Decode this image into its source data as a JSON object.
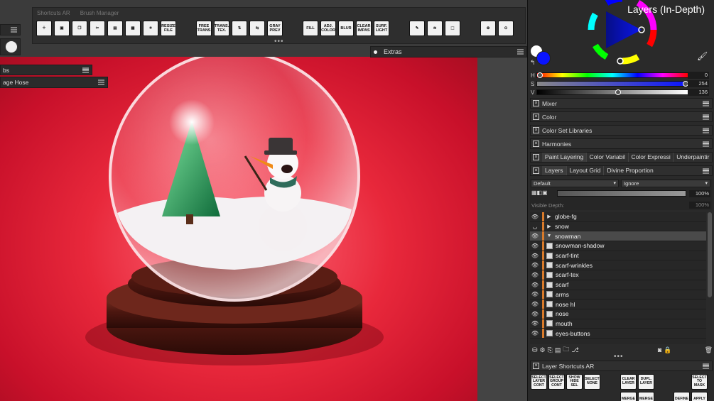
{
  "toolbar": {
    "tabs": [
      "Shortcuts AR",
      "Brush Manager"
    ],
    "buttons": [
      {
        "id": "new",
        "label": "",
        "icon": "new-doc-icon"
      },
      {
        "id": "save",
        "label": "",
        "icon": "save-icon"
      },
      {
        "id": "copy-merged",
        "label": "",
        "icon": "copy-icon"
      },
      {
        "id": "cut",
        "label": "",
        "icon": "scissors-icon"
      },
      {
        "id": "copy",
        "label": "",
        "icon": "copy-layer-icon"
      },
      {
        "id": "paste",
        "label": "",
        "icon": "paste-icon"
      },
      {
        "id": "crop",
        "label": "",
        "icon": "crop-icon"
      },
      {
        "id": "resize",
        "label": "RESIZE FILE"
      },
      {
        "id": "free-trans",
        "label": "FREE TRANS"
      },
      {
        "id": "trans-tex",
        "label": "TRANS. TEX."
      },
      {
        "id": "flip",
        "label": "",
        "icon": "flip-icon"
      },
      {
        "id": "mirror",
        "label": "",
        "icon": "mirror-icon"
      },
      {
        "id": "gray-prev",
        "label": "GRAY PREV"
      },
      {
        "id": "fill",
        "label": "FILL"
      },
      {
        "id": "adj-color",
        "label": "ADJ. COLOR"
      },
      {
        "id": "blur",
        "label": "BLUR"
      },
      {
        "id": "clear-impas",
        "label": "CLEAR IMPAS"
      },
      {
        "id": "surf-light",
        "label": "SURF. LIGHT"
      },
      {
        "id": "brush-a",
        "label": "",
        "icon": "brush-icon"
      },
      {
        "id": "brush-b",
        "label": "",
        "icon": "brush-stroke-icon"
      },
      {
        "id": "brush-c",
        "label": "",
        "icon": "cube-brush-icon"
      },
      {
        "id": "zoom-fit",
        "label": "",
        "icon": "zoom-fit-icon"
      },
      {
        "id": "zoom-100",
        "label": "",
        "icon": "zoom-100-icon"
      }
    ]
  },
  "left_panels": {
    "tab_fragment": "bs",
    "hose_label": "age Hose"
  },
  "extras": {
    "title": "Extras"
  },
  "color_panel": {
    "title": "Layers (In-Depth)",
    "sliders": [
      {
        "label": "H",
        "value": "0",
        "fraction": 0.0
      },
      {
        "label": "S",
        "value": "254",
        "fraction": 0.996
      },
      {
        "label": "V",
        "value": "136",
        "fraction": 0.533
      }
    ],
    "fg_color": "#ffffff",
    "bg_color": "#0a14ff"
  },
  "dockers": [
    {
      "title": "Mixer"
    },
    {
      "title": "Color"
    },
    {
      "title": "Color Set Libraries"
    },
    {
      "title": "Harmonies"
    }
  ],
  "paint_tabs": [
    "Paint Layering",
    "Color Variabil",
    "Color Expressi",
    "Underpaintir"
  ],
  "layers_tabs": [
    "Layers",
    "Layout Grid",
    "Divine Proportion"
  ],
  "layers_controls": {
    "blend_mode": "Default",
    "ignore_mode": "Ignore",
    "opacity": "100%",
    "visible_depth_label": "Visible Depth:",
    "visible_depth_value": "100%"
  },
  "layers": [
    {
      "name": "globe-fg",
      "type": "group",
      "expanded": false,
      "visible": true
    },
    {
      "name": "snow",
      "type": "group",
      "expanded": false,
      "visible": false
    },
    {
      "name": "snowman",
      "type": "group",
      "expanded": true,
      "visible": true,
      "selected": true
    },
    {
      "name": "snowman-shadow",
      "type": "layer",
      "visible": true
    },
    {
      "name": "scarf-tint",
      "type": "layer",
      "visible": true
    },
    {
      "name": "scarf-wrinkles",
      "type": "layer",
      "visible": true
    },
    {
      "name": "scarf-tex",
      "type": "layer",
      "visible": true
    },
    {
      "name": "scarf",
      "type": "layer",
      "visible": true
    },
    {
      "name": "arms",
      "type": "layer",
      "visible": true
    },
    {
      "name": "nose hl",
      "type": "layer",
      "visible": true
    },
    {
      "name": "nose",
      "type": "layer",
      "visible": true
    },
    {
      "name": "mouth",
      "type": "layer",
      "visible": true
    },
    {
      "name": "eyes-buttons",
      "type": "layer",
      "visible": true
    }
  ],
  "layer_shortcuts": {
    "title": "Layer Shortcuts AR",
    "buttons": [
      "SELECT LAYER CONT",
      "SELECT GROUP CONT",
      "SHOW HIDE SEL",
      "SELECT NONE",
      "CLEAR LAYER",
      "DUPL. LAYER",
      "SELECT TO MASK",
      "MERGE",
      "MERGE",
      "DEFINE",
      "APPLY"
    ]
  },
  "colors": {
    "accent_orange": "#d97a2a",
    "canvas_red": "#e8283b"
  }
}
